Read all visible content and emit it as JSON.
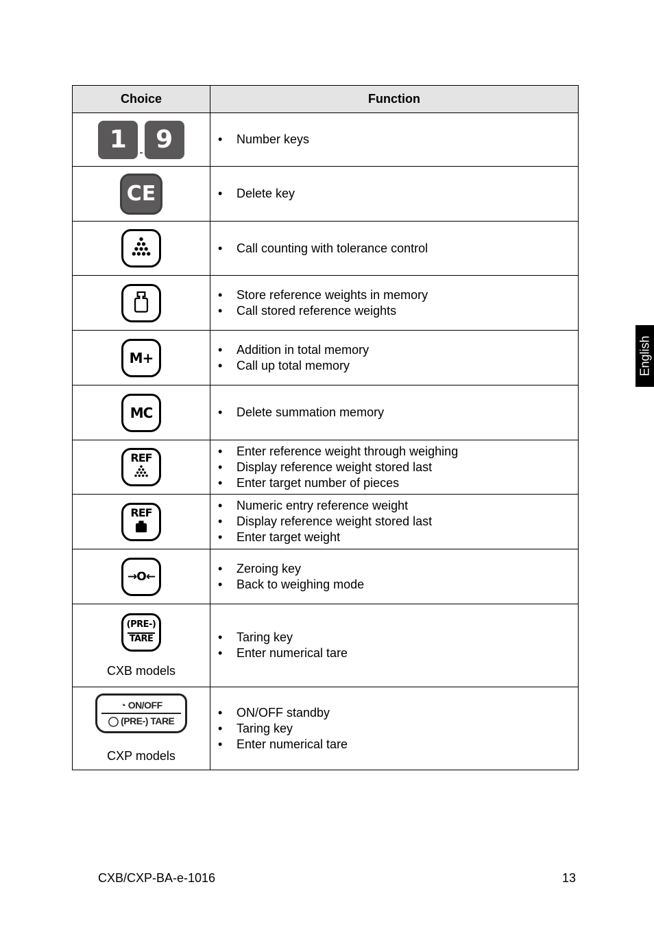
{
  "table": {
    "headers": {
      "choice": "Choice",
      "function": "Function"
    },
    "rows": [
      {
        "key": "number-keys",
        "key_label_start": "1",
        "key_label_end": "9",
        "range_separator": "-",
        "functions": [
          "Number keys"
        ]
      },
      {
        "key": "delete-key",
        "key_label": "CE",
        "functions": [
          "Delete key"
        ]
      },
      {
        "key": "counting-key",
        "functions": [
          "Call counting with tolerance control"
        ]
      },
      {
        "key": "weight-memory-key",
        "functions": [
          "Store reference weights in memory",
          "Call stored reference weights"
        ]
      },
      {
        "key": "m-plus-key",
        "key_label": "M+",
        "functions": [
          "Addition in total memory",
          "Call up total memory"
        ]
      },
      {
        "key": "mc-key",
        "key_label": "MC",
        "functions": [
          "Delete summation memory"
        ]
      },
      {
        "key": "ref-count-key",
        "key_label": "REF",
        "functions": [
          "Enter reference weight through weighing",
          "Display reference weight stored last",
          "Enter target number of pieces"
        ]
      },
      {
        "key": "ref-weight-key",
        "key_label": "REF",
        "functions": [
          "Numeric entry reference weight",
          "Display reference weight stored last",
          "Enter target weight"
        ]
      },
      {
        "key": "zero-key",
        "key_label": "→O←",
        "functions": [
          "Zeroing key",
          "Back to weighing mode"
        ]
      },
      {
        "key": "tare-key-cxb",
        "key_label_top": "(PRE-)",
        "key_label_bottom": "TARE",
        "model_note": "CXB models",
        "functions": [
          "Taring key",
          "Enter numerical tare"
        ]
      },
      {
        "key": "on-off-tare-key-cxp",
        "key_label_top": "ON/OFF",
        "key_label_bottom": "(PRE-) TARE",
        "model_note": "CXP models",
        "functions": [
          "ON/OFF standby",
          "Taring key",
          "Enter numerical tare"
        ]
      }
    ]
  },
  "side_tab": {
    "label": "English"
  },
  "footer": {
    "doc_id": "CXB/CXP-BA-e-1016",
    "page_number": "13"
  }
}
